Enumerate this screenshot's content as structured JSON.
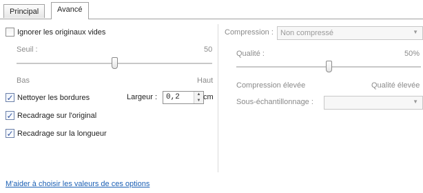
{
  "tabs": [
    {
      "label": "Principal",
      "active": false
    },
    {
      "label": "Avancé",
      "active": true
    }
  ],
  "left": {
    "ignore_blank": {
      "label": "Ignorer les originaux vides",
      "checked": false
    },
    "threshold": {
      "label": "Seuil :",
      "value": "50",
      "min_label": "Bas",
      "max_label": "Haut",
      "level": 0.5
    },
    "clean_borders": {
      "label": "Nettoyer les bordures",
      "checked": true
    },
    "width": {
      "label": "Largeur :",
      "value": "0,2",
      "unit": "cm"
    },
    "crop_original": {
      "label": "Recadrage sur l'original",
      "checked": true
    },
    "crop_length": {
      "label": "Recadrage sur la longueur",
      "checked": true
    }
  },
  "right": {
    "compression": {
      "label": "Compression :",
      "value": "Non compressé",
      "enabled": false
    },
    "quality": {
      "label": "Qualité :",
      "value": "50%",
      "min_label": "Compression élevée",
      "max_label": "Qualité élevée",
      "level": 0.5
    },
    "subsampling": {
      "label": "Sous-échantillonnage :",
      "value": "",
      "enabled": false
    }
  },
  "help_link": "M'aider à choisir les valeurs de ces options",
  "icons": {
    "check": "checkmark-icon",
    "spin_up": "spin-up-icon",
    "spin_down": "spin-down-icon",
    "dropdown": "chevron-down-icon"
  }
}
